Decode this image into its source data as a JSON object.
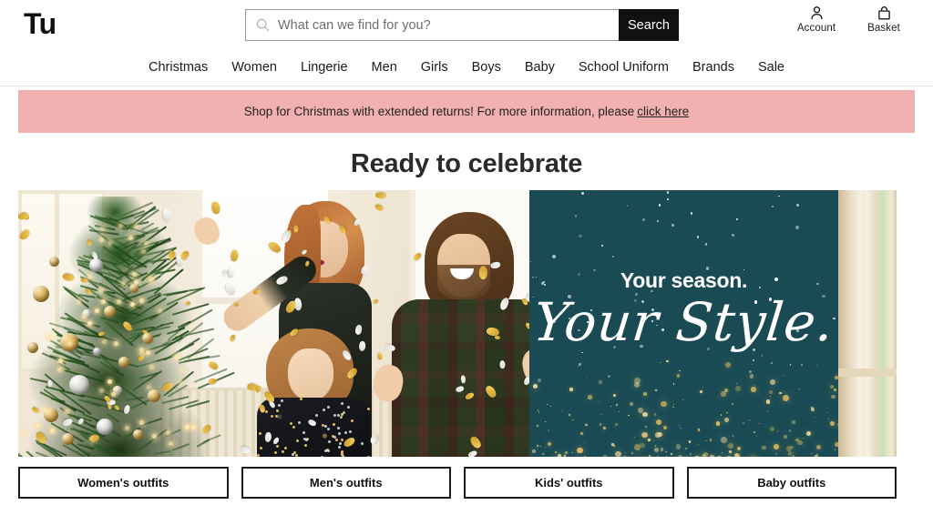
{
  "header": {
    "logo": "Tu",
    "search": {
      "placeholder": "What can we find for you?",
      "value": "",
      "button_label": "Search",
      "icon": "search-icon"
    },
    "actions": [
      {
        "label": "Account",
        "icon": "person-icon"
      },
      {
        "label": "Basket",
        "icon": "basket-icon"
      }
    ]
  },
  "nav": {
    "items": [
      {
        "label": "Christmas"
      },
      {
        "label": "Women"
      },
      {
        "label": "Lingerie"
      },
      {
        "label": "Men"
      },
      {
        "label": "Girls"
      },
      {
        "label": "Boys"
      },
      {
        "label": "Baby"
      },
      {
        "label": "School Uniform"
      },
      {
        "label": "Brands"
      },
      {
        "label": "Sale"
      }
    ]
  },
  "banner": {
    "text": "Shop for Christmas with extended returns! For more information, please",
    "link_label": "click here",
    "background_color": "#f2b1b1"
  },
  "main": {
    "title": "Ready to celebrate",
    "hero": {
      "panel": {
        "line1": "Your season.",
        "line2": "Your Style.",
        "background_color": "#1a4b55",
        "text_color": "#ffffff"
      }
    },
    "outfit_buttons": [
      {
        "label": "Women's outfits"
      },
      {
        "label": "Men's outfits"
      },
      {
        "label": "Kids' outfits"
      },
      {
        "label": "Baby outfits"
      }
    ]
  }
}
